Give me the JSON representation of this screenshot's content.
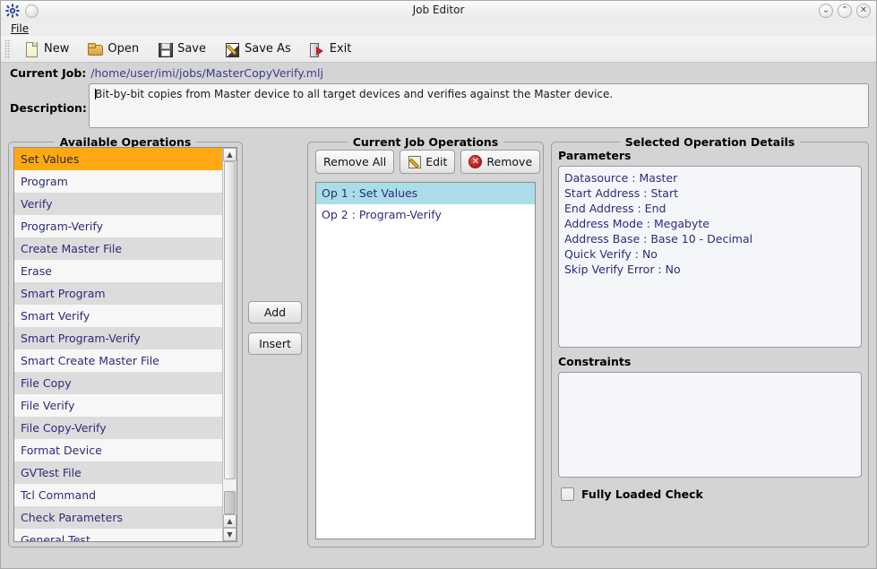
{
  "window": {
    "title": "Job Editor",
    "gear_icon": "gear-icon",
    "dot_icon": "circle-icon",
    "controls": [
      {
        "name": "minimize",
        "glyph": "⌄"
      },
      {
        "name": "maximize",
        "glyph": "⌃"
      },
      {
        "name": "close",
        "glyph": "✕"
      }
    ]
  },
  "menubar": {
    "items": [
      {
        "label": "File",
        "accel": "F"
      }
    ]
  },
  "toolbar": {
    "buttons": [
      {
        "label": "New",
        "icon": "new-document-icon",
        "icon_class": "ico-new"
      },
      {
        "label": "Open",
        "icon": "open-folder-icon",
        "icon_class": "ico-open"
      },
      {
        "label": "Save",
        "icon": "floppy-disk-icon",
        "icon_class": "ico-save"
      },
      {
        "label": "Save As",
        "icon": "save-as-icon",
        "icon_class": "ico-saveas"
      },
      {
        "label": "Exit",
        "icon": "exit-door-icon",
        "icon_class": "ico-exit"
      }
    ]
  },
  "current_job": {
    "label": "Current Job:",
    "path": "/home/user/imi/jobs/MasterCopyVerify.mlj"
  },
  "description": {
    "label": "Description:",
    "value": "Bit-by-bit copies from Master device to all target devices and verifies against the Master device.",
    "placeholder": ""
  },
  "available_operations": {
    "title": "Available Operations",
    "selected_index": 0,
    "items": [
      "Set Values",
      "Program",
      "Verify",
      "Program-Verify",
      "Create Master File",
      "Erase",
      "Smart Program",
      "Smart Verify",
      "Smart Program-Verify",
      "Smart Create Master File",
      "File Copy",
      "File Verify",
      "File Copy-Verify",
      "Format Device",
      "GVTest File",
      "Tcl Command",
      "Check Parameters",
      "General Test"
    ]
  },
  "transfer_buttons": {
    "add_label": "Add",
    "insert_label": "Insert"
  },
  "current_job_operations": {
    "title": "Current Job Operations",
    "buttons": [
      {
        "label": "Remove All",
        "icon": ""
      },
      {
        "label": "Edit",
        "icon": "edit-pencil-icon"
      },
      {
        "label": "Remove",
        "icon": "remove-circle-icon"
      }
    ],
    "selected_index": 0,
    "items": [
      "Op 1 : Set Values",
      "Op 2 : Program-Verify"
    ]
  },
  "selected_operation_details": {
    "title": "Selected Operation Details",
    "parameters_label": "Parameters",
    "parameters": [
      "Datasource : Master",
      "Start Address : Start",
      "End Address : End",
      "Address Mode : Megabyte",
      "Address Base : Base 10 - Decimal",
      "Quick Verify : No",
      "Skip Verify Error : No"
    ],
    "constraints_label": "Constraints",
    "constraints": [],
    "fully_loaded_check_label": "Fully Loaded Check",
    "fully_loaded_check_value": false
  },
  "colors": {
    "selection_orange": "#ffa912",
    "selection_cyan": "#aadde8",
    "link_blue": "#2c2c7a",
    "window_bg": "#d4d4d4",
    "field_bg": "#f4f6fa"
  }
}
